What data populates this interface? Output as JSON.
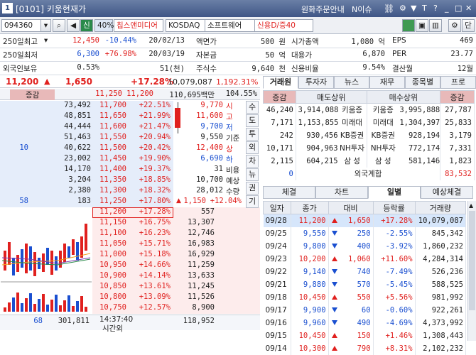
{
  "window": {
    "number": "1",
    "title": "[0101] 키움현재가",
    "notice": "원화주문안내",
    "issue": "N이슈"
  },
  "toolbar": {
    "code": "094360",
    "market_label": "신",
    "margin": "40%",
    "name": "칩스앤미디어",
    "market": "KOSDAQ",
    "sector": "소프트웨어",
    "credit": "신용D/증40",
    "single_btn": "단"
  },
  "info": {
    "rows": [
      {
        "c1": "250일최고",
        "c2": "12,450",
        "c3": "-10.44%",
        "c4": "20/02/13",
        "c5": "액면가",
        "c6": "500 원",
        "c7": "시가총액",
        "c8": "1,080 억",
        "c9": "EPS",
        "c10": "469"
      },
      {
        "c1": "250일최저",
        "c2": "6,300",
        "c3": "+76.98%",
        "c4": "20/03/19",
        "c5": "자본금",
        "c6": "50 억",
        "c7": "대용가",
        "c8": "6,870",
        "c9": "PER",
        "c10": "23.77"
      },
      {
        "c1": "외국인보유",
        "c2": "0.53%",
        "c3": "",
        "c4": "51(천)",
        "c5": "주식수",
        "c6": "9,640 천",
        "c7": "신용비율",
        "c8": "9.54%",
        "c9": "결산월",
        "c10": "12월"
      }
    ]
  },
  "banner": {
    "price": "11,200",
    "change": "1,650",
    "rate": "+17.28%",
    "volume": "10,079,087",
    "sub": "1,192.31%"
  },
  "ob_head": {
    "label": "증감",
    "p1": "11,250",
    "p2": "11,200",
    "amount": "110,695백만",
    "pct": "104.55%"
  },
  "asks": [
    {
      "vol": "73,492",
      "price": "11,700",
      "rate": "+22.51%",
      "chg": ""
    },
    {
      "vol": "48,851",
      "price": "11,650",
      "rate": "+21.99%",
      "chg": ""
    },
    {
      "vol": "44,444",
      "price": "11,600",
      "rate": "+21.47%",
      "chg": ""
    },
    {
      "vol": "51,463",
      "price": "11,550",
      "rate": "+20.94%",
      "chg": ""
    },
    {
      "vol": "40,622",
      "price": "11,500",
      "rate": "+20.42%",
      "chg": "10"
    },
    {
      "vol": "23,002",
      "price": "11,450",
      "rate": "+19.90%",
      "chg": ""
    },
    {
      "vol": "14,170",
      "price": "11,400",
      "rate": "+19.37%",
      "chg": ""
    },
    {
      "vol": "3,204",
      "price": "11,350",
      "rate": "+18.85%",
      "chg": ""
    },
    {
      "vol": "2,380",
      "price": "11,300",
      "rate": "+18.32%",
      "chg": ""
    },
    {
      "vol": "183",
      "price": "11,250",
      "rate": "+17.80%",
      "chg": "58"
    }
  ],
  "bids": [
    {
      "price": "11,200",
      "rate": "+17.28%",
      "vol": "557"
    },
    {
      "price": "11,150",
      "rate": "+16.75%",
      "vol": "13,307"
    },
    {
      "price": "11,100",
      "rate": "+16.23%",
      "vol": "12,746"
    },
    {
      "price": "11,050",
      "rate": "+15.71%",
      "vol": "16,983"
    },
    {
      "price": "11,000",
      "rate": "+15.18%",
      "vol": "16,929"
    },
    {
      "price": "10,950",
      "rate": "+14.66%",
      "vol": "11,259"
    },
    {
      "price": "10,900",
      "rate": "+14.14%",
      "vol": "13,633"
    },
    {
      "price": "10,850",
      "rate": "+13.61%",
      "vol": "11,245"
    },
    {
      "price": "10,800",
      "rate": "+13.09%",
      "vol": "11,526"
    },
    {
      "price": "10,750",
      "rate": "+12.57%",
      "vol": "8,900"
    }
  ],
  "summary": {
    "v1": "9,770",
    "l1": "시",
    "v2": "11,600",
    "l2": "고",
    "v3": "9,700",
    "l3": "저",
    "v4": "9,550",
    "l4": "기준",
    "v5": "12,400",
    "l5": "상",
    "v6": "6,690",
    "l6": "하",
    "v7": "31",
    "l7": "비용",
    "v8": "10,700",
    "l8": "예상",
    "v9": "28,012",
    "l9": "수량",
    "v10": "1,150",
    "v11": "+12.04%"
  },
  "side_tabs": [
    "수",
    "도",
    "투",
    "외",
    "차",
    "뉴",
    "권",
    "기"
  ],
  "ob_foot": {
    "a": "68",
    "b": "301,811",
    "time": "14:37:40",
    "time_label": "시간외",
    "c": "118,952"
  },
  "right_tabs": [
    "거래원",
    "투자자",
    "뉴스",
    "재무",
    "종목별",
    "프로"
  ],
  "broker_head": {
    "c1": "증감",
    "c2": "매도상위",
    "c3": "매수상위",
    "c4": "증감"
  },
  "brokers": [
    {
      "d1": "46,240",
      "sv": "3,914,088",
      "sn": "키움증",
      "bn": "키움증",
      "bv": "3,995,888",
      "d2": "27,787"
    },
    {
      "d1": "7,171",
      "sv": "1,153,855",
      "sn": "미래대",
      "bn": "미래대",
      "bv": "1,304,397",
      "d2": "25,833"
    },
    {
      "d1": "242",
      "sv": "930,456",
      "sn": "KB증권",
      "bn": "KB증권",
      "bv": "928,194",
      "d2": "3,179"
    },
    {
      "d1": "10,171",
      "sv": "904,963",
      "sn": "NH투자",
      "bn": "NH투자",
      "bv": "772,174",
      "d2": "7,331"
    },
    {
      "d1": "2,115",
      "sv": "604,215",
      "sn": "삼 성",
      "bn": "삼 성",
      "bv": "581,146",
      "d2": "1,823"
    }
  ],
  "foreign": {
    "d1": "0",
    "label": "외국계합",
    "val": "83,532"
  },
  "lower_tabs": [
    "체결",
    "차트",
    "일별",
    "예상체결"
  ],
  "daily_head": [
    "일자",
    "종가",
    "대비",
    "등락률",
    "거래량"
  ],
  "daily": [
    {
      "date": "09/28",
      "close": "11,200",
      "dir": "up",
      "diff": "1,650",
      "rate": "+17.28%",
      "vol": "10,079,087"
    },
    {
      "date": "09/25",
      "close": "9,550",
      "dir": "down",
      "diff": "250",
      "rate": "-2.55%",
      "vol": "845,342"
    },
    {
      "date": "09/24",
      "close": "9,800",
      "dir": "down",
      "diff": "400",
      "rate": "-3.92%",
      "vol": "1,860,232"
    },
    {
      "date": "09/23",
      "close": "10,200",
      "dir": "up",
      "diff": "1,060",
      "rate": "+11.60%",
      "vol": "4,284,314"
    },
    {
      "date": "09/22",
      "close": "9,140",
      "dir": "down",
      "diff": "740",
      "rate": "-7.49%",
      "vol": "526,236"
    },
    {
      "date": "09/21",
      "close": "9,880",
      "dir": "down",
      "diff": "570",
      "rate": "-5.45%",
      "vol": "588,525"
    },
    {
      "date": "09/18",
      "close": "10,450",
      "dir": "up",
      "diff": "550",
      "rate": "+5.56%",
      "vol": "981,992"
    },
    {
      "date": "09/17",
      "close": "9,900",
      "dir": "down",
      "diff": "60",
      "rate": "-0.60%",
      "vol": "922,261"
    },
    {
      "date": "09/16",
      "close": "9,960",
      "dir": "down",
      "diff": "490",
      "rate": "-4.69%",
      "vol": "4,373,992"
    },
    {
      "date": "09/15",
      "close": "10,450",
      "dir": "up",
      "diff": "150",
      "rate": "+1.46%",
      "vol": "1,308,443"
    },
    {
      "date": "09/14",
      "close": "10,300",
      "dir": "up",
      "diff": "790",
      "rate": "+8.31%",
      "vol": "2,102,232"
    }
  ]
}
